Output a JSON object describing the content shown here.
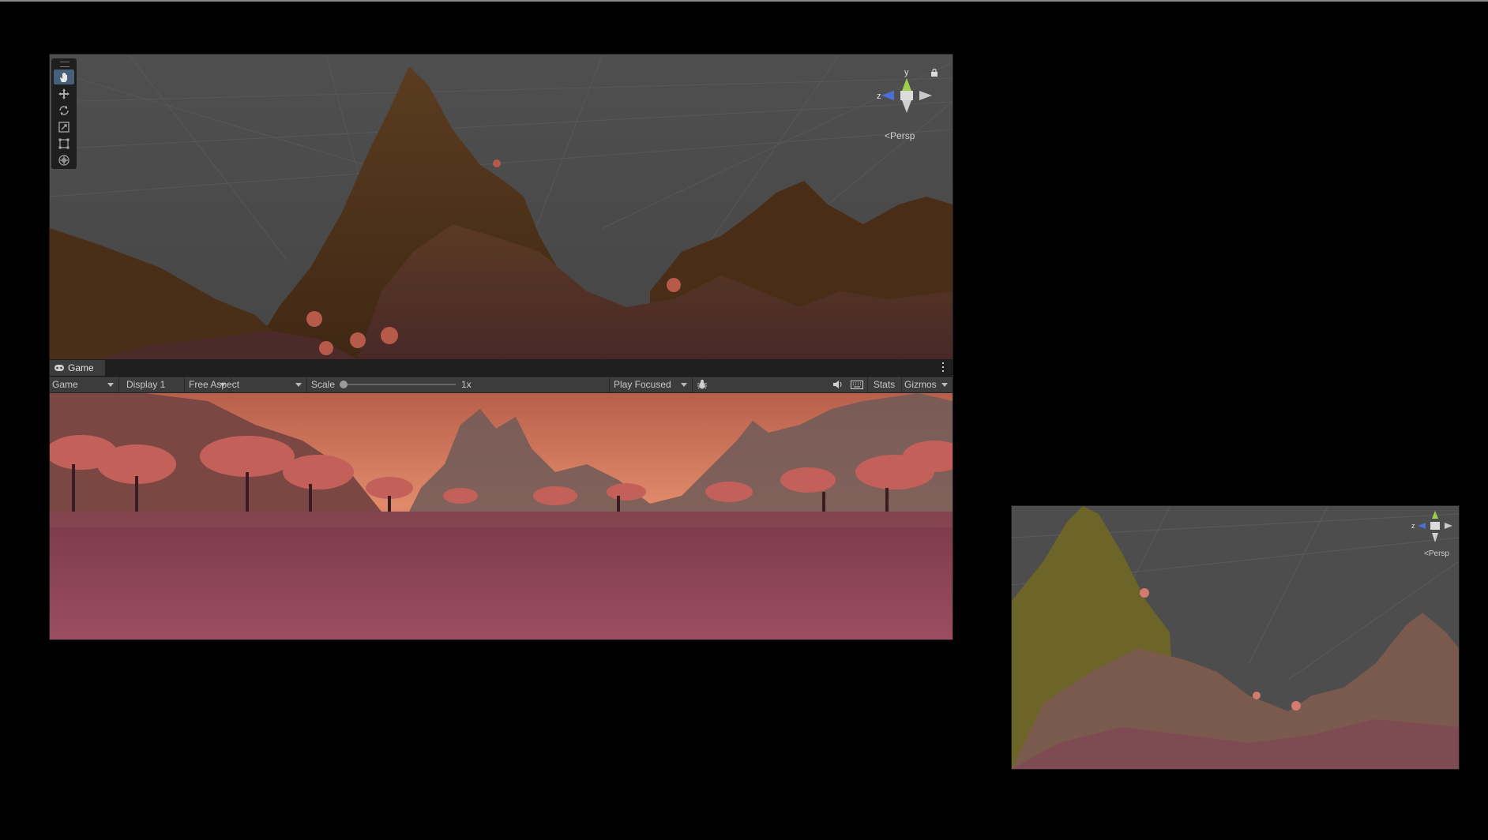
{
  "scene_view": {
    "tools": [
      {
        "name": "hand-tool",
        "active": true
      },
      {
        "name": "move-tool",
        "active": false
      },
      {
        "name": "rotate-tool",
        "active": false
      },
      {
        "name": "scale-tool",
        "active": false
      },
      {
        "name": "rect-tool",
        "active": false
      },
      {
        "name": "transform-tool",
        "active": false
      }
    ],
    "gizmo": {
      "y_label": "y",
      "z_label": "z",
      "persp_label": "Persp"
    }
  },
  "game_view": {
    "tab_label": "Game",
    "toolbar": {
      "view_select": "Game",
      "display_select": "Display 1",
      "aspect_select": "Free Aspect",
      "scale_label": "Scale",
      "scale_value": "1x",
      "play_mode_select": "Play Focused",
      "stats_label": "Stats",
      "gizmos_label": "Gizmos"
    }
  },
  "mini_scene": {
    "gizmo": {
      "z_label": "z",
      "persp_label": "Persp"
    }
  },
  "colors": {
    "accent_active": "#46607c",
    "editor_bg": "#3c3c3c",
    "gizmo_y": "#9dd14a",
    "gizmo_z": "#4a6fd6"
  }
}
